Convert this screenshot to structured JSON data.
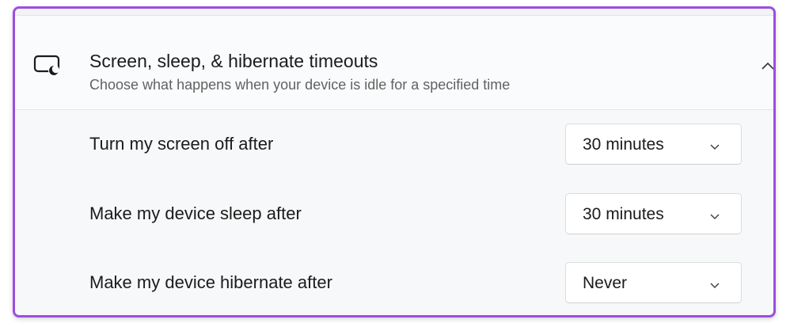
{
  "section": {
    "title": "Screen, sleep, & hibernate timeouts",
    "subtitle": "Choose what happens when your device is idle for a specified time",
    "icon": "screen-sleep-icon",
    "expanded": true
  },
  "settings": [
    {
      "label": "Turn my screen off after",
      "value": "30 minutes"
    },
    {
      "label": "Make my device sleep after",
      "value": "30 minutes"
    },
    {
      "label": "Make my device hibernate after",
      "value": "Never"
    }
  ],
  "colors": {
    "highlight_border": "#9b4ee0",
    "panel_background": "#f7f8fa"
  }
}
